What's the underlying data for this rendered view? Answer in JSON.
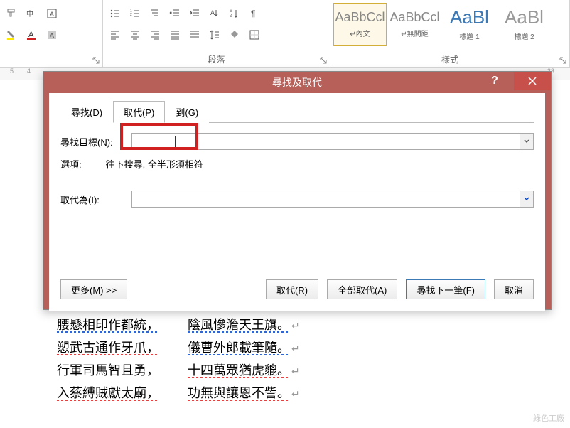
{
  "ribbon": {
    "paragraph_label": "段落",
    "styles_label": "樣式",
    "styles": [
      {
        "preview": "AaBbCcl",
        "name": "↵內文"
      },
      {
        "preview": "AaBbCcl",
        "name": "↵無間距"
      },
      {
        "preview": "AaBl",
        "name": "標題 1"
      },
      {
        "preview": "AaBl",
        "name": "標題 2"
      }
    ]
  },
  "ruler": {
    "n1": "5",
    "n2": "4",
    "n3": "33"
  },
  "dialog": {
    "title": "尋找及取代",
    "tabs": {
      "find": "尋找(D)",
      "replace": "取代(P)",
      "goto": "到(G)"
    },
    "find_label": "尋找目標(N):",
    "options_label": "選項:",
    "options_value": "往下搜尋, 全半形須相符",
    "replace_label": "取代為(I):",
    "buttons": {
      "more": "更多(M) >>",
      "replace": "取代(R)",
      "replace_all": "全部取代(A)",
      "find_next": "尋找下一筆(F)",
      "cancel": "取消"
    }
  },
  "document": {
    "lines": [
      {
        "l": "腰懸相印作都統，",
        "r": "陰風慘澹天王旗。"
      },
      {
        "l": "愬武古通作牙爪，",
        "r": "儀曹外郎載筆隨。"
      },
      {
        "l": "行軍司馬智且勇，",
        "r": "十四萬眾猶虎貔。"
      },
      {
        "l": "入蔡縛賊獻太廟，",
        "r": "功無與讓恩不訾。"
      }
    ]
  },
  "watermark": "綠色工廠"
}
